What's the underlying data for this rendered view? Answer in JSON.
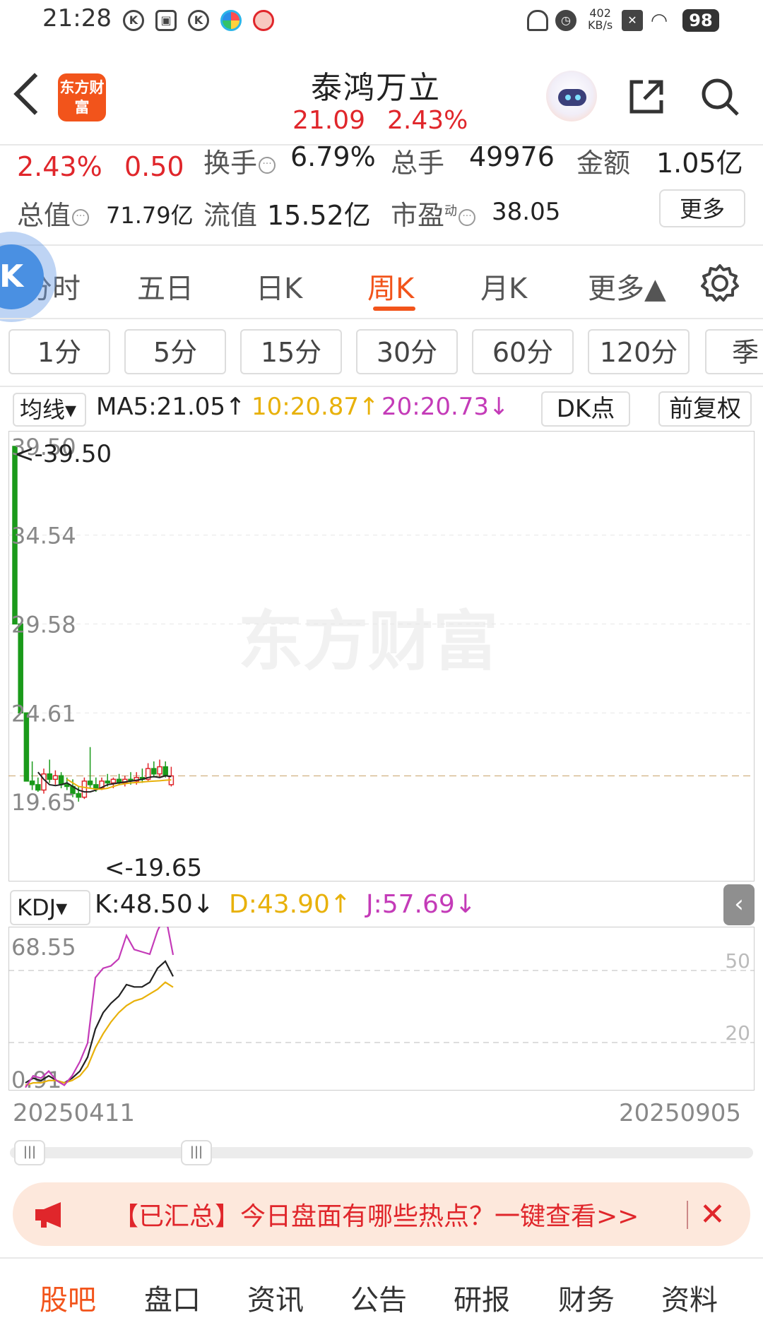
{
  "status_bar": {
    "time": "21:28",
    "rate_value": "402",
    "rate_unit": "KB/s",
    "battery": "98"
  },
  "header": {
    "logo": "东方财富",
    "title": "泰鸿万立",
    "price": "21.09",
    "change_pct": "2.43%"
  },
  "quote": {
    "change_pct": "2.43%",
    "change": "0.50",
    "turnover_label": "换手",
    "turnover": "6.79%",
    "volume_label": "总手",
    "volume": "49976",
    "amount_label": "金额",
    "amount": "1.05亿",
    "mktcap_label": "总值",
    "mktcap": "71.79亿",
    "float_label": "流值",
    "float_cap": "15.52亿",
    "pe_label": "市盈",
    "pe_sup": "动",
    "pe": "38.05",
    "more": "更多"
  },
  "period_tabs": [
    "分时",
    "五日",
    "日K",
    "周K",
    "月K",
    "更多▲"
  ],
  "minute_buttons": [
    "1分",
    "5分",
    "15分",
    "30分",
    "60分",
    "120分",
    "季"
  ],
  "ma_row": {
    "select": "均线▾",
    "ma5": "MA5:21.05↑",
    "ma10": "10:20.87↑",
    "ma20": "20:20.73↓",
    "dk": "DK点",
    "fuquan": "前复权"
  },
  "main_chart": {
    "y_ticks": [
      "39.50",
      "34.54",
      "29.58",
      "24.61",
      "19.65"
    ],
    "high_marker": "<-39.50",
    "low_marker": "<-19.65",
    "watermark": "东方财富"
  },
  "kdj_row": {
    "select": "KDJ▾",
    "k": "K:48.50↓",
    "d": "D:43.90↑",
    "j": "J:57.69↓"
  },
  "kdj_chart": {
    "y_max": "68.55",
    "y_min": "0.91",
    "lvl50": "50",
    "lvl20": "20"
  },
  "dates": {
    "start": "20250411",
    "end": "20250905"
  },
  "scroll_handle": "|||",
  "banner": {
    "text": "【已汇总】今日盘面有哪些热点？一键查看>>",
    "close": "✕"
  },
  "bottom_tabs": [
    "股吧",
    "盘口",
    "资讯",
    "公告",
    "研报",
    "财务",
    "资料"
  ],
  "colors": {
    "up": "#e0262b",
    "down": "#1a9a1a",
    "accent": "#f2541b",
    "ma10": "#e8b10a",
    "ma20": "#c43bb8"
  },
  "chart_data": [
    {
      "type": "candlestick",
      "title": "周K",
      "ylim": [
        19.65,
        39.5
      ],
      "candles": [
        {
          "o": 39.5,
          "h": 39.5,
          "l": 29.58,
          "c": 29.58
        },
        {
          "o": 29.58,
          "h": 29.58,
          "l": 24.61,
          "c": 24.61
        },
        {
          "o": 24.61,
          "h": 24.61,
          "l": 20.8,
          "c": 20.8
        },
        {
          "o": 20.8,
          "h": 21.9,
          "l": 20.3,
          "c": 20.6
        },
        {
          "o": 20.6,
          "h": 21.0,
          "l": 20.2,
          "c": 20.3
        },
        {
          "o": 20.3,
          "h": 21.5,
          "l": 20.1,
          "c": 21.2
        },
        {
          "o": 21.2,
          "h": 22.0,
          "l": 20.7,
          "c": 20.9
        },
        {
          "o": 20.9,
          "h": 21.4,
          "l": 20.6,
          "c": 21.1
        },
        {
          "o": 21.1,
          "h": 21.3,
          "l": 20.4,
          "c": 20.6
        },
        {
          "o": 20.6,
          "h": 21.0,
          "l": 20.3,
          "c": 20.5
        },
        {
          "o": 20.5,
          "h": 20.9,
          "l": 19.9,
          "c": 20.1
        },
        {
          "o": 20.1,
          "h": 20.5,
          "l": 19.65,
          "c": 19.9
        },
        {
          "o": 19.9,
          "h": 21.0,
          "l": 19.8,
          "c": 20.8
        },
        {
          "o": 20.8,
          "h": 22.7,
          "l": 20.4,
          "c": 20.6
        },
        {
          "o": 20.6,
          "h": 21.0,
          "l": 20.2,
          "c": 20.4
        },
        {
          "o": 20.4,
          "h": 21.0,
          "l": 20.3,
          "c": 20.8
        },
        {
          "o": 20.8,
          "h": 21.2,
          "l": 20.5,
          "c": 20.7
        },
        {
          "o": 20.7,
          "h": 21.0,
          "l": 20.4,
          "c": 20.9
        },
        {
          "o": 20.9,
          "h": 21.2,
          "l": 20.6,
          "c": 20.7
        },
        {
          "o": 20.7,
          "h": 21.1,
          "l": 20.5,
          "c": 20.9
        },
        {
          "o": 20.9,
          "h": 21.3,
          "l": 20.6,
          "c": 20.8
        },
        {
          "o": 20.8,
          "h": 21.3,
          "l": 20.6,
          "c": 21.0
        },
        {
          "o": 21.0,
          "h": 21.5,
          "l": 20.7,
          "c": 20.9
        },
        {
          "o": 20.9,
          "h": 21.8,
          "l": 20.8,
          "c": 21.5
        },
        {
          "o": 21.5,
          "h": 21.9,
          "l": 21.0,
          "c": 21.2
        },
        {
          "o": 21.2,
          "h": 22.0,
          "l": 21.0,
          "c": 21.6
        },
        {
          "o": 21.6,
          "h": 21.9,
          "l": 21.0,
          "c": 21.1
        },
        {
          "o": 20.6,
          "h": 21.6,
          "l": 20.5,
          "c": 21.09
        }
      ],
      "ma": [
        {
          "name": "MA5",
          "values": [
            null,
            null,
            null,
            null,
            21.3,
            20.9,
            20.6,
            20.55,
            20.6,
            20.7,
            20.5,
            20.3,
            20.2,
            20.2,
            20.3,
            20.45,
            20.6,
            20.65,
            20.7,
            20.75,
            20.8,
            20.85,
            20.9,
            21.0,
            21.05,
            21.0,
            21.1,
            21.05
          ]
        },
        {
          "name": "MA10",
          "values": [
            null,
            null,
            null,
            null,
            null,
            null,
            null,
            null,
            null,
            20.9,
            20.7,
            20.5,
            20.45,
            20.4,
            20.35,
            20.35,
            20.4,
            20.5,
            20.6,
            20.65,
            20.7,
            20.72,
            20.75,
            20.78,
            20.8,
            20.82,
            20.85,
            20.87
          ]
        }
      ],
      "last_close_line": 21.09
    },
    {
      "type": "line",
      "title": "KDJ",
      "ylim": [
        0.91,
        68.55
      ],
      "series": [
        {
          "name": "K",
          "values": [
            3,
            5,
            4,
            6,
            4,
            3,
            5,
            8,
            14,
            26,
            33,
            37,
            40,
            45,
            44,
            44,
            46,
            52,
            55,
            48.5
          ]
        },
        {
          "name": "D",
          "values": [
            2,
            3,
            3,
            4,
            4,
            3,
            4,
            6,
            10,
            18,
            24,
            29,
            33,
            36,
            38,
            39,
            41,
            43,
            46,
            43.9
          ]
        },
        {
          "name": "J",
          "values": [
            1,
            6,
            5,
            8,
            4,
            2,
            6,
            12,
            20,
            48,
            52,
            53,
            56,
            66,
            60,
            59,
            58,
            68,
            75,
            57.69
          ]
        }
      ]
    }
  ]
}
